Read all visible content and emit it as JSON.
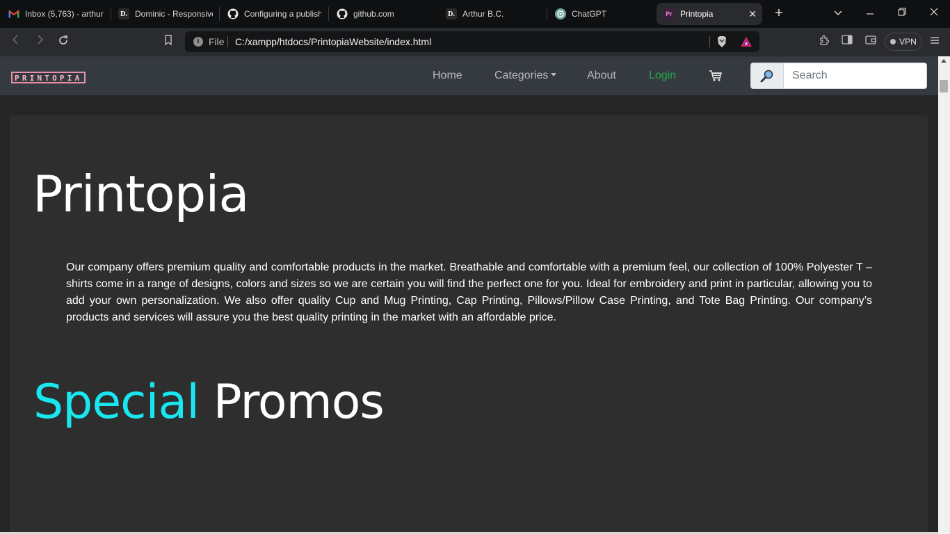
{
  "browser": {
    "tabs": [
      {
        "title": "Inbox (5,763) - arthur",
        "icon": "gmail-icon"
      },
      {
        "title": "Dominic - Responsive",
        "icon": "d-dot-icon"
      },
      {
        "title": "Configuring a publish",
        "icon": "github-icon"
      },
      {
        "title": "github.com",
        "icon": "github-icon"
      },
      {
        "title": "Arthur B.C.",
        "icon": "d-dot-icon"
      },
      {
        "title": "ChatGPT",
        "icon": "chatgpt-icon"
      },
      {
        "title": "Printopia",
        "icon": "printopia-favicon",
        "active": true
      }
    ],
    "new_tab": "+",
    "address": {
      "scheme_label": "File",
      "url": "C:/xampp/htdocs/PrintopiaWebsite/index.html"
    },
    "vpn_label": "VPN"
  },
  "site": {
    "logo_text": "PRINTOPIA",
    "nav": {
      "home": "Home",
      "categories": "Categories",
      "about": "About",
      "login": "Login"
    },
    "search": {
      "placeholder": "Search"
    },
    "hero": {
      "title": "Printopia",
      "description": "Our company offers premium quality and comfortable products in the market. Breathable and comfortable with a premium feel, our collection of 100% Polyester T – shirts come in a range of designs, colors and sizes so we are certain you will find the perfect one for you. Ideal for embroidery and print in particular, allowing you to add your own personalization. We also offer quality Cup and Mug Printing, Cap Printing, Pillows/Pillow Case Printing, and Tote Bag Printing. Our company’s products and services will assure you the best quality printing in the market with an affordable price."
    },
    "promos": {
      "title_highlight": "Special",
      "title_rest": "Promos"
    }
  },
  "colors": {
    "navbar": "#343a40",
    "login_link": "#28a745",
    "promo_accent": "#18e7ef",
    "logo_border": "#e88fa6"
  }
}
